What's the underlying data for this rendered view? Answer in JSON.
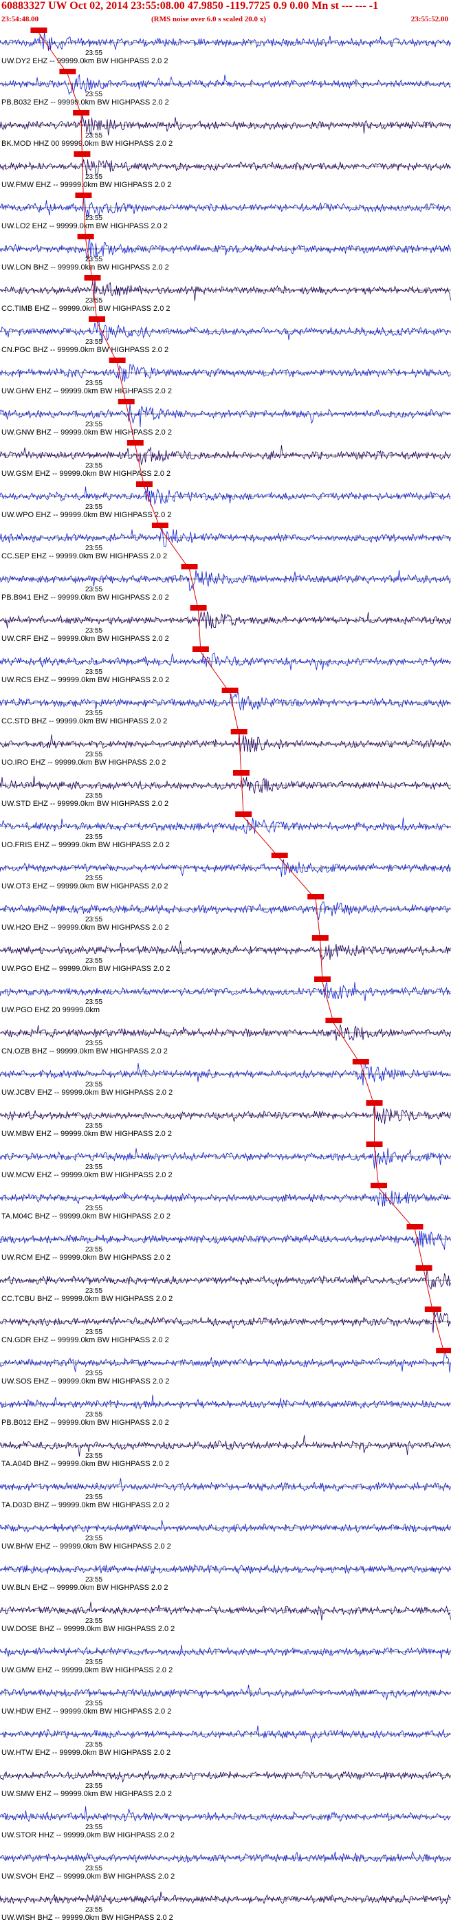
{
  "header": {
    "event_line": "60883327 UW Oct 02, 2014 23:55:08.00   47.9850 -119.7725  0.9 0.00 Mn st --- --- -1",
    "start_time": "23:54:48.00",
    "rms_note": "(RMS noise over 6.0 s scaled 20.0 x)",
    "end_time": "23:55:52.00"
  },
  "tick_time_label": "23:55",
  "colors": {
    "trace_blue": "#1020d8",
    "trace_dark": "#200060",
    "pick_red": "#e00000",
    "header_red": "#d40000"
  },
  "traces": [
    {
      "label": "UW.DY2 EHZ -- 99999.0km BW  HIGHPASS  2.0  2",
      "pick": 0.086
    },
    {
      "label": "PB.B032 EHZ -- 99999.0km BW  HIGHPASS  2.0  2",
      "pick": 0.15
    },
    {
      "label": "BK.MOD HHZ 00 99999.0km BW  HIGHPASS  2.0  2",
      "pick": 0.18
    },
    {
      "label": "UW.FMW EHZ -- 99999.0km BW  HIGHPASS  2.0  2",
      "pick": 0.182
    },
    {
      "label": "UW.LO2 EHZ -- 99999.0km BW  HIGHPASS  2.0  2",
      "pick": 0.185
    },
    {
      "label": "UW.LON BHZ -- 99999.0km BW  HIGHPASS  2.0  2",
      "pick": 0.19
    },
    {
      "label": "CC.TIMB EHZ -- 99999.0km BW  HIGHPASS  2.0  2",
      "pick": 0.205
    },
    {
      "label": "CN.PGC BHZ -- 99999.0km BW  HIGHPASS  2.0  2",
      "pick": 0.215
    },
    {
      "label": "UW.GHW EHZ -- 99999.0km BW  HIGHPASS  2.0  2",
      "pick": 0.26
    },
    {
      "label": "UW.GNW BHZ -- 99999.0km BW  HIGHPASS  2.0  2",
      "pick": 0.28
    },
    {
      "label": "UW.GSM EHZ -- 99999.0km BW  HIGHPASS  2.0  2",
      "pick": 0.3
    },
    {
      "label": "UW.WPO EHZ -- 99999.0km BW  HIGHPASS  2.0  2",
      "pick": 0.32
    },
    {
      "label": "CC.SEP EHZ -- 99999.0km BW  HIGHPASS  2.0  2",
      "pick": 0.355
    },
    {
      "label": "PB.B941 EHZ -- 99999.0km BW  HIGHPASS  2.0  2",
      "pick": 0.42
    },
    {
      "label": "UW.CRF EHZ -- 99999.0km BW  HIGHPASS  2.0  2",
      "pick": 0.44
    },
    {
      "label": "UW.RCS EHZ -- 99999.0km BW  HIGHPASS  2.0  2",
      "pick": 0.445
    },
    {
      "label": "CC.STD BHZ -- 99999.0km BW  HIGHPASS  2.0  2",
      "pick": 0.51
    },
    {
      "label": "UO.IRO EHZ -- 99999.0km BW  HIGHPASS  2.0  2",
      "pick": 0.53
    },
    {
      "label": "UW.STD EHZ -- 99999.0km BW  HIGHPASS  2.0  2",
      "pick": 0.535
    },
    {
      "label": "UO.FRIS EHZ -- 99999.0km BW  HIGHPASS  2.0  2",
      "pick": 0.54
    },
    {
      "label": "UW.OT3 EHZ -- 99999.0km BW  HIGHPASS  2.0  2",
      "pick": 0.62
    },
    {
      "label": "UW.H2O EHZ -- 99999.0km BW  HIGHPASS  2.0  2",
      "pick": 0.7
    },
    {
      "label": "UW.PGO EHZ -- 99999.0km BW  HIGHPASS  2.0  2",
      "pick": 0.71
    },
    {
      "label": "UW.PGO EHZ 20 99999.0km",
      "pick": 0.715
    },
    {
      "label": "CN.OZB BHZ -- 99999.0km BW  HIGHPASS  2.0  2",
      "pick": 0.74
    },
    {
      "label": "UW.JCBV EHZ -- 99999.0km BW  HIGHPASS  2.0  2",
      "pick": 0.8
    },
    {
      "label": "UW.MBW EHZ -- 99999.0km BW  HIGHPASS  2.0  2",
      "pick": 0.83
    },
    {
      "label": "UW.MCW EHZ -- 99999.0km BW  HIGHPASS  2.0  2",
      "pick": 0.83
    },
    {
      "label": "TA.M04C BHZ -- 99999.0km BW  HIGHPASS  2.0  2",
      "pick": 0.84
    },
    {
      "label": "UW.RCM EHZ -- 99999.0km BW  HIGHPASS  2.0  2",
      "pick": 0.92
    },
    {
      "label": "CC.TCBU BHZ -- 99999.0km BW  HIGHPASS  2.0  2",
      "pick": 0.94
    },
    {
      "label": "CN.GDR EHZ -- 99999.0km BW  HIGHPASS  2.0  2",
      "pick": 0.96
    },
    {
      "label": "UW.SOS EHZ -- 99999.0km BW  HIGHPASS  2.0  2",
      "pick": 0.985
    },
    {
      "label": "PB.B012 EHZ -- 99999.0km BW  HIGHPASS  2.0  2",
      "pick": null
    },
    {
      "label": "TA.A04D BHZ -- 99999.0km BW  HIGHPASS  2.0  2",
      "pick": null
    },
    {
      "label": "TA.D03D BHZ -- 99999.0km BW  HIGHPASS  2.0  2",
      "pick": null
    },
    {
      "label": "UW.BHW EHZ -- 99999.0km BW  HIGHPASS  2.0  2",
      "pick": null
    },
    {
      "label": "UW.BLN EHZ -- 99999.0km BW  HIGHPASS  2.0  2",
      "pick": null
    },
    {
      "label": "UW.DOSE BHZ -- 99999.0km BW  HIGHPASS  2.0  2",
      "pick": null
    },
    {
      "label": "UW.GMW EHZ -- 99999.0km BW  HIGHPASS  2.0  2",
      "pick": null
    },
    {
      "label": "UW.HDW EHZ -- 99999.0km BW  HIGHPASS  2.0  2",
      "pick": null
    },
    {
      "label": "UW.HTW EHZ -- 99999.0km BW  HIGHPASS  2.0  2",
      "pick": null
    },
    {
      "label": "UW.SMW EHZ -- 99999.0km BW  HIGHPASS  2.0  2",
      "pick": null
    },
    {
      "label": "UW.STOR HHZ -- 99999.0km BW  HIGHPASS  2.0  2",
      "pick": null
    },
    {
      "label": "UW.SVOH EHZ -- 99999.0km BW  HIGHPASS  2.0  2",
      "pick": null
    },
    {
      "label": "UW.WISH BHZ -- 99999.0km BW  HIGHPASS  2.0  2",
      "pick": null
    }
  ]
}
